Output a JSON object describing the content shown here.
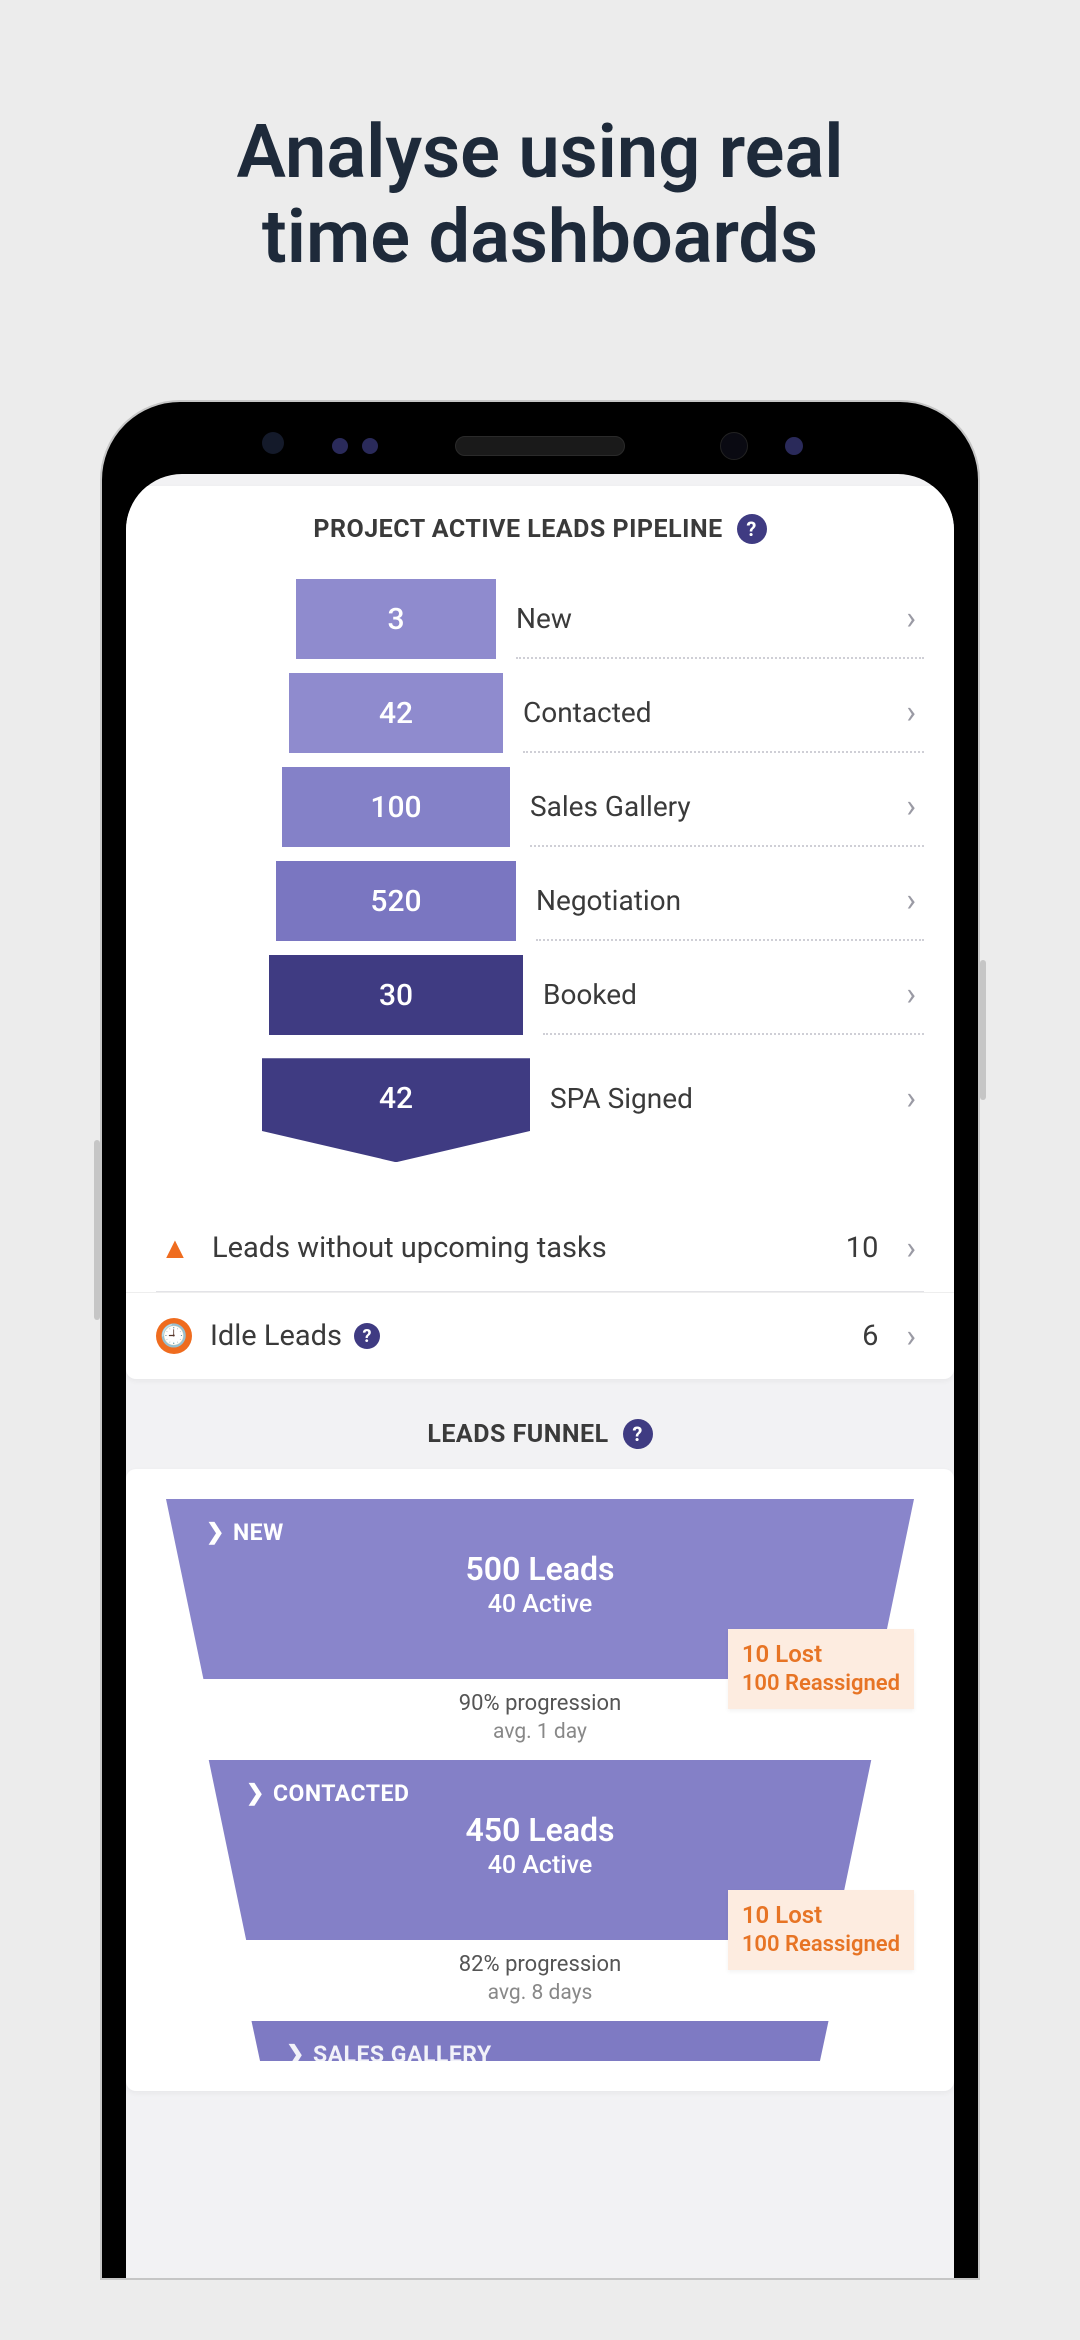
{
  "headline_line1": "Analyse using real",
  "headline_line2": "time dashboards",
  "colors": {
    "light": "#8f8bce",
    "medium": "#7a76c1",
    "dark": "#3f3b82",
    "accent": "#ef6c1f"
  },
  "pipeline": {
    "title": "PROJECT ACTIVE LEADS PIPELINE",
    "stages": [
      {
        "count": "3",
        "label": "New",
        "shade": "light"
      },
      {
        "count": "42",
        "label": "Contacted",
        "shade": "light"
      },
      {
        "count": "100",
        "label": "Sales Gallery",
        "shade": "light"
      },
      {
        "count": "520",
        "label": "Negotiation",
        "shade": "light"
      },
      {
        "count": "30",
        "label": "Booked",
        "shade": "dark"
      },
      {
        "count": "42",
        "label": "SPA Signed",
        "shade": "dark"
      }
    ],
    "alerts": [
      {
        "icon": "warning-triangle",
        "label": "Leads without upcoming tasks",
        "count": "10",
        "help": false
      },
      {
        "icon": "clock",
        "label": "Idle Leads",
        "count": "6",
        "help": true
      }
    ]
  },
  "funnel": {
    "title": "LEADS FUNNEL",
    "stages": [
      {
        "name": "NEW",
        "leads": "500 Leads",
        "active": "40 Active",
        "progression": "90% progression",
        "avg": "avg. 1 day",
        "lost": "10 Lost",
        "reassigned": "100 Reassigned"
      },
      {
        "name": "CONTACTED",
        "leads": "450 Leads",
        "active": "40 Active",
        "progression": "82% progression",
        "avg": "avg. 8 days",
        "lost": "10 Lost",
        "reassigned": "100 Reassigned"
      },
      {
        "name": "SALES GALLERY",
        "leads": "",
        "active": "",
        "progression": "",
        "avg": "",
        "lost": "",
        "reassigned": ""
      }
    ]
  },
  "help_glyph": "?"
}
